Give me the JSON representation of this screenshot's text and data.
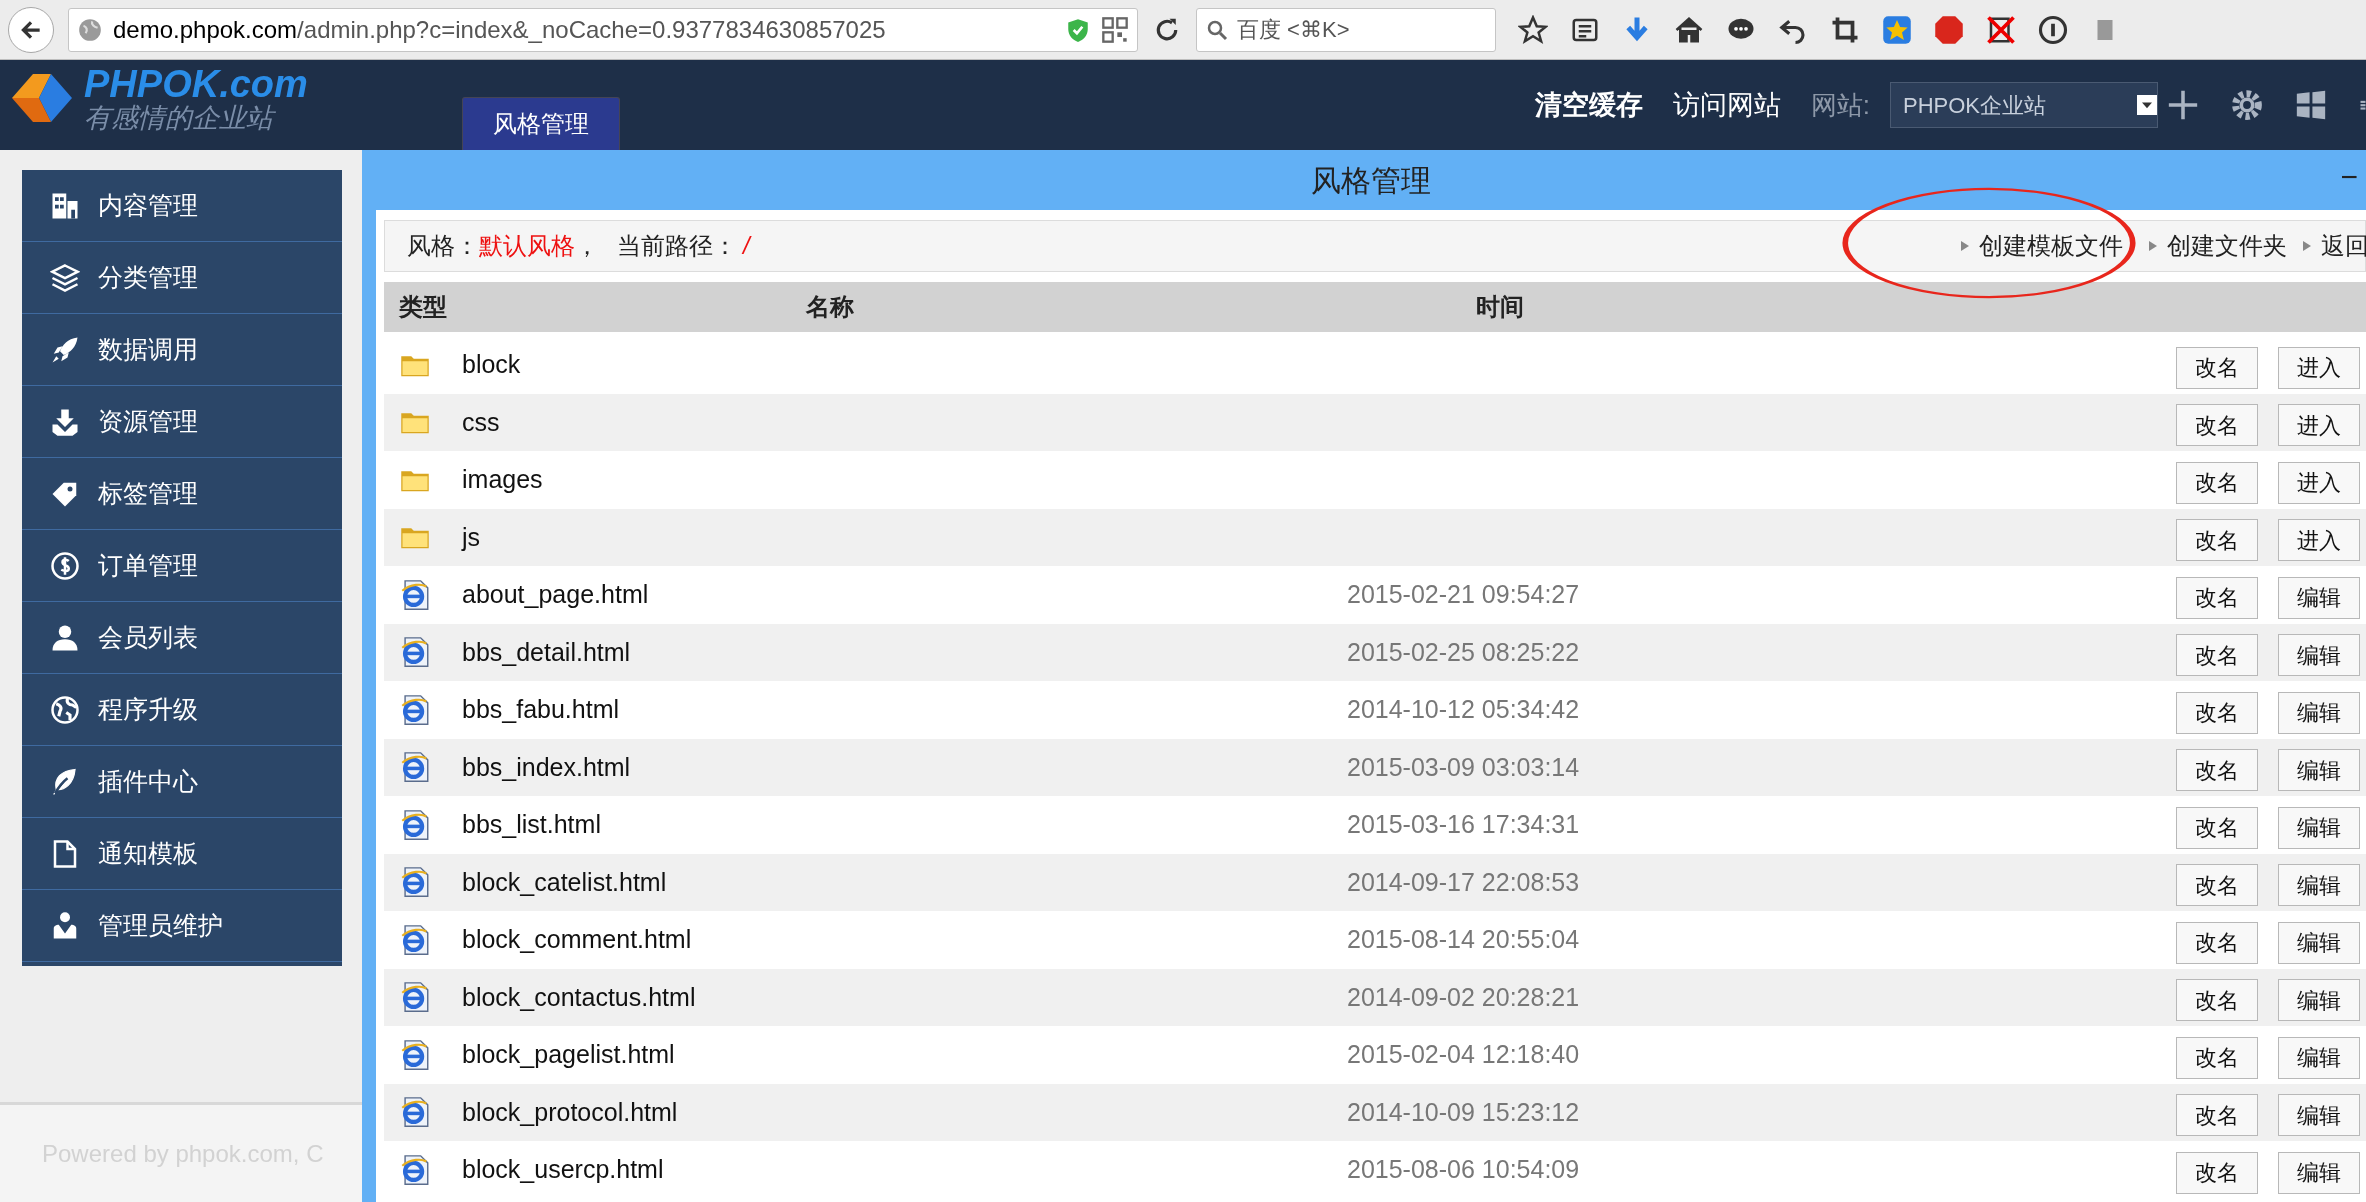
{
  "browser": {
    "url_host": "demo.phpok.com",
    "url_rest": "/admin.php?c=index&_noCache=0.9377834630857025",
    "search_placeholder": "百度 <⌘K>"
  },
  "header": {
    "logo_title": "PHPOK.com",
    "logo_slogan": "有感情的企业站",
    "tabs": [
      {
        "label": "风格管理",
        "selected": true
      }
    ],
    "links": [
      "清空缓存",
      "访问网站"
    ],
    "site_label": "网站:",
    "site_select": "PHPOK企业站"
  },
  "sidebar": {
    "items": [
      {
        "label": "内容管理"
      },
      {
        "label": "分类管理"
      },
      {
        "label": "数据调用"
      },
      {
        "label": "资源管理"
      },
      {
        "label": "标签管理"
      },
      {
        "label": "订单管理"
      },
      {
        "label": "会员列表"
      },
      {
        "label": "程序升级"
      },
      {
        "label": "插件中心"
      },
      {
        "label": "通知模板"
      },
      {
        "label": "管理员维护"
      }
    ],
    "footer": "Powered by phpok.com, C"
  },
  "panel": {
    "title": "风格管理",
    "collapse": "−",
    "path_bar": {
      "style_label": "风格：",
      "style_value": "默认风格",
      "separator": "，",
      "path_label": "当前路径：",
      "path_value": "/"
    },
    "actions": [
      {
        "label": "创建模板文件"
      },
      {
        "label": "创建文件夹"
      },
      {
        "label": "返回"
      }
    ],
    "annotation": {
      "kind": "ellipse"
    },
    "table": {
      "columns": [
        "类型",
        "名称",
        "时间"
      ],
      "rows": [
        {
          "kind": "folder",
          "name": "block",
          "buttons": [
            "改名",
            "进入"
          ]
        },
        {
          "kind": "folder",
          "name": "css",
          "buttons": [
            "改名",
            "进入"
          ]
        },
        {
          "kind": "folder",
          "name": "images",
          "buttons": [
            "改名",
            "进入"
          ]
        },
        {
          "kind": "folder",
          "name": "js",
          "buttons": [
            "改名",
            "进入"
          ]
        },
        {
          "kind": "file",
          "name": "about_page.html",
          "time": "2015-02-21 09:54:27",
          "buttons": [
            "改名",
            "编辑"
          ]
        },
        {
          "kind": "file",
          "name": "bbs_detail.html",
          "time": "2015-02-25 08:25:22",
          "buttons": [
            "改名",
            "编辑"
          ]
        },
        {
          "kind": "file",
          "name": "bbs_fabu.html",
          "time": "2014-10-12 05:34:42",
          "buttons": [
            "改名",
            "编辑"
          ]
        },
        {
          "kind": "file",
          "name": "bbs_index.html",
          "time": "2015-03-09 03:03:14",
          "buttons": [
            "改名",
            "编辑"
          ]
        },
        {
          "kind": "file",
          "name": "bbs_list.html",
          "time": "2015-03-16 17:34:31",
          "buttons": [
            "改名",
            "编辑"
          ]
        },
        {
          "kind": "file",
          "name": "block_catelist.html",
          "time": "2014-09-17 22:08:53",
          "buttons": [
            "改名",
            "编辑"
          ]
        },
        {
          "kind": "file",
          "name": "block_comment.html",
          "time": "2015-08-14 20:55:04",
          "buttons": [
            "改名",
            "编辑"
          ]
        },
        {
          "kind": "file",
          "name": "block_contactus.html",
          "time": "2014-09-02 20:28:21",
          "buttons": [
            "改名",
            "编辑"
          ]
        },
        {
          "kind": "file",
          "name": "block_pagelist.html",
          "time": "2015-02-04 12:18:40",
          "buttons": [
            "改名",
            "编辑"
          ]
        },
        {
          "kind": "file",
          "name": "block_protocol.html",
          "time": "2014-10-09 15:23:12",
          "buttons": [
            "改名",
            "编辑"
          ]
        },
        {
          "kind": "file",
          "name": "block_usercp.html",
          "time": "2015-08-06 10:54:09",
          "buttons": [
            "改名",
            "编辑"
          ]
        }
      ]
    }
  }
}
